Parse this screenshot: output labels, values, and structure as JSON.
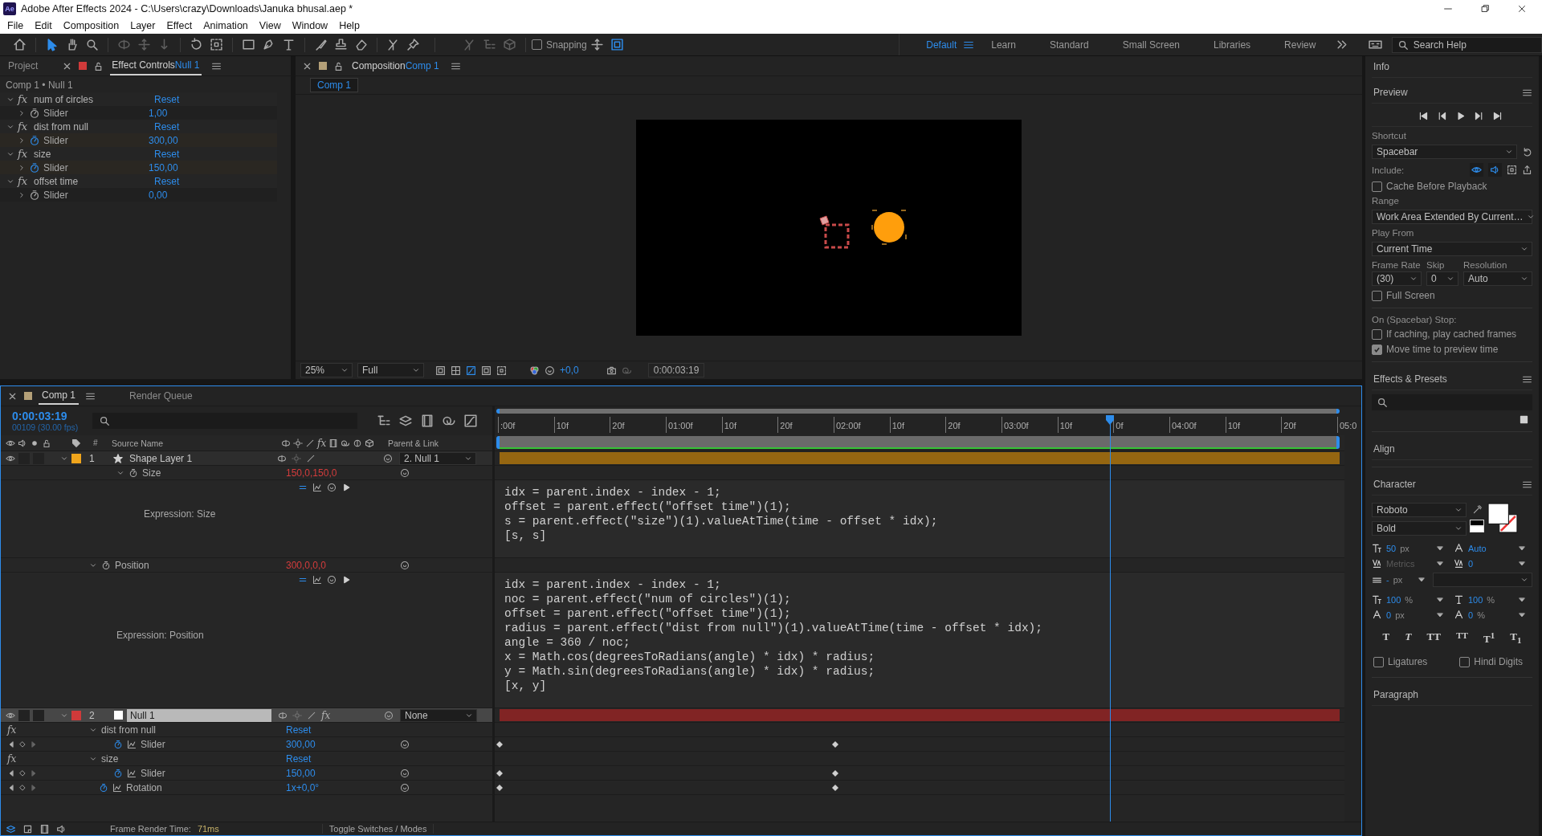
{
  "window": {
    "logo": "Ae",
    "title": "Adobe After Effects 2024 - C:\\Users\\crazy\\Downloads\\Januka bhusal.aep *"
  },
  "menu": [
    "File",
    "Edit",
    "Composition",
    "Layer",
    "Effect",
    "Animation",
    "View",
    "Window",
    "Help"
  ],
  "toolbar": {
    "snapping": {
      "label": "Snapping",
      "checked": false
    }
  },
  "workspaces": [
    {
      "label": "Default",
      "selected": true
    },
    {
      "label": "Learn",
      "selected": false
    },
    {
      "label": "Standard",
      "selected": false
    },
    {
      "label": "Small Screen",
      "selected": false
    },
    {
      "label": "Libraries",
      "selected": false
    },
    {
      "label": "Review",
      "selected": false
    }
  ],
  "search_help": {
    "placeholder": "Search Help"
  },
  "effect_controls": {
    "tabs": [
      {
        "label": "Project",
        "selected": false
      },
      {
        "label": "Effect Controls",
        "target": "Null 1",
        "selected": true
      }
    ],
    "breadcrumb": "Comp 1 • Null 1",
    "effects": [
      {
        "badge": "fx",
        "name": "num of circles",
        "reset": "Reset",
        "param": "Slider",
        "value": "1,00",
        "animated": false
      },
      {
        "badge": "fx",
        "name": "dist from null",
        "reset": "Reset",
        "param": "Slider",
        "value": "300,00",
        "animated": true
      },
      {
        "badge": "fx",
        "name": "size",
        "reset": "Reset",
        "param": "Slider",
        "value": "150,00",
        "animated": true
      },
      {
        "badge": "fx",
        "name": "offset time",
        "reset": "Reset",
        "param": "Slider",
        "value": "0,00",
        "animated": false
      }
    ]
  },
  "composition": {
    "title": "Composition",
    "comp": "Comp 1",
    "view_tab": {
      "label": "Comp 1",
      "selected": true
    },
    "zoom": "25%",
    "resolution": "Full",
    "exposure": "+0,0",
    "timecode": "0:00:03:19"
  },
  "timeline": {
    "tabs": [
      {
        "label": "Comp 1",
        "selected": true
      },
      {
        "label": "Render Queue",
        "selected": false
      }
    ],
    "timecode": "0:00:03:19",
    "frame_info": "00109 (30.00 fps)",
    "columns": {
      "number": "#",
      "source_name": "Source Name",
      "fx": "fx",
      "parent": "Parent & Link"
    },
    "ruler": [
      ":00f",
      "10f",
      "20f",
      "01:00f",
      "10f",
      "20f",
      "02:00f",
      "10f",
      "20f",
      "03:00f",
      "10f",
      "0f",
      "04:00f",
      "10f",
      "20f",
      "05:0"
    ],
    "playhead": {
      "level": 0.727
    },
    "layers": [
      {
        "number": "1",
        "name": "Shape Layer 1",
        "kind": "shape",
        "color": "#f0a51c",
        "selected": false,
        "parent": "2. Null 1",
        "properties": [
          {
            "kind": "content",
            "name": "Size",
            "value": "150,0,150,0",
            "expression": {
              "label": "Expression: Size",
              "code": [
                "idx = parent.index - index - 1;",
                "offset = parent.effect(\"offset time\")(1);",
                "s = parent.effect(\"size\")(1).valueAtTime(time - offset * idx);",
                "[s, s]"
              ]
            }
          },
          {
            "kind": "transform",
            "name": "Position",
            "value": "300,0,0,0",
            "expression": {
              "label": "Expression: Position",
              "code": [
                "idx = parent.index - index - 1;",
                "noc = parent.effect(\"num of circles\")(1);",
                "offset = parent.effect(\"offset time\")(1);",
                "radius = parent.effect(\"dist from null\")(1).valueAtTime(time - offset * idx);",
                "angle = 360 / noc;",
                "x = Math.cos(degreesToRadians(angle) * idx) * radius;",
                "y = Math.sin(degreesToRadians(angle) * idx) * radius;",
                "[x, y]"
              ]
            }
          }
        ]
      },
      {
        "number": "2",
        "name": "Null 1",
        "kind": "null",
        "color": "#d03a3a",
        "selected": true,
        "fx_switch": "fx",
        "parent": "None",
        "properties": [
          {
            "kind": "effect",
            "badge": "fx",
            "name": "dist from null",
            "value": "Reset"
          },
          {
            "kind": "effect-param",
            "name": "Slider",
            "value": "300,00",
            "keyframes": [
              {
                "level": 0
              },
              {
                "level": 0.4
              }
            ]
          },
          {
            "kind": "effect",
            "badge": "fx",
            "name": "size",
            "value": "Reset"
          },
          {
            "kind": "effect-param",
            "name": "Slider",
            "value": "150,00",
            "keyframes": [
              {
                "level": 0
              },
              {
                "level": 0.4
              }
            ]
          },
          {
            "kind": "layer-param",
            "name": "Rotation",
            "value": "1x+0,0°",
            "keyframes": [
              {
                "level": 0
              },
              {
                "level": 0.4
              }
            ]
          }
        ]
      }
    ],
    "footer": {
      "render_label": "Frame Render Time:",
      "render_time": "71ms",
      "toggle": "Toggle Switches / Modes"
    }
  },
  "right_panel": {
    "info": "Info",
    "preview": {
      "title": "Preview",
      "shortcut_label": "Shortcut",
      "shortcut": "Spacebar",
      "include_label": "Include:",
      "cache_before": {
        "label": "Cache Before Playback",
        "checked": false
      },
      "range_label": "Range",
      "range": "Work Area Extended By Current…",
      "play_from_label": "Play From",
      "play_from": "Current Time",
      "frame_rate_label": "Frame Rate",
      "skip_label": "Skip",
      "resolution_label": "Resolution",
      "frame_rate": "(30)",
      "skip": "0",
      "resolution": "Auto",
      "full_screen": {
        "label": "Full Screen",
        "checked": false
      },
      "stop_label": "On (Spacebar) Stop:",
      "if_caching": {
        "label": "If caching, play cached frames",
        "checked": false
      },
      "move_time": {
        "label": "Move time to preview time",
        "checked": true
      }
    },
    "effects_presets": {
      "title": "Effects & Presets"
    },
    "align": "Align",
    "character": {
      "title": "Character",
      "font": "Roboto",
      "style": "Bold",
      "metrics": [
        {
          "kind": "font-size",
          "value": "50",
          "unit": "px"
        },
        {
          "kind": "leading",
          "value": "Auto"
        },
        {
          "kind": "kerning",
          "value": "Metrics",
          "disabled": true
        },
        {
          "kind": "tracking",
          "value": "0"
        }
      ],
      "stroke": {
        "value": "-",
        "unit": "px"
      },
      "scales": [
        {
          "kind": "vertical-scale",
          "value": "100",
          "unit": "%"
        },
        {
          "kind": "horizontal-scale",
          "value": "100",
          "unit": "%"
        },
        {
          "kind": "baseline",
          "value": "0",
          "unit": "px"
        },
        {
          "kind": "tsume",
          "value": "0",
          "unit": "%"
        }
      ],
      "text_styles": [
        {
          "kind": "bold",
          "text": "T"
        },
        {
          "kind": "italic",
          "text": "T"
        },
        {
          "kind": "caps",
          "text": "TT"
        },
        {
          "kind": "small-caps",
          "text": "TT"
        },
        {
          "kind": "super",
          "text": "T$^{1}$"
        },
        {
          "kind": "sub",
          "text": "T$_{1}$"
        }
      ],
      "ligatures": {
        "label": "Ligatures",
        "checked": false
      },
      "hindi_digits": {
        "label": "Hindi Digits",
        "checked": false
      }
    },
    "paragraph": "Paragraph"
  }
}
